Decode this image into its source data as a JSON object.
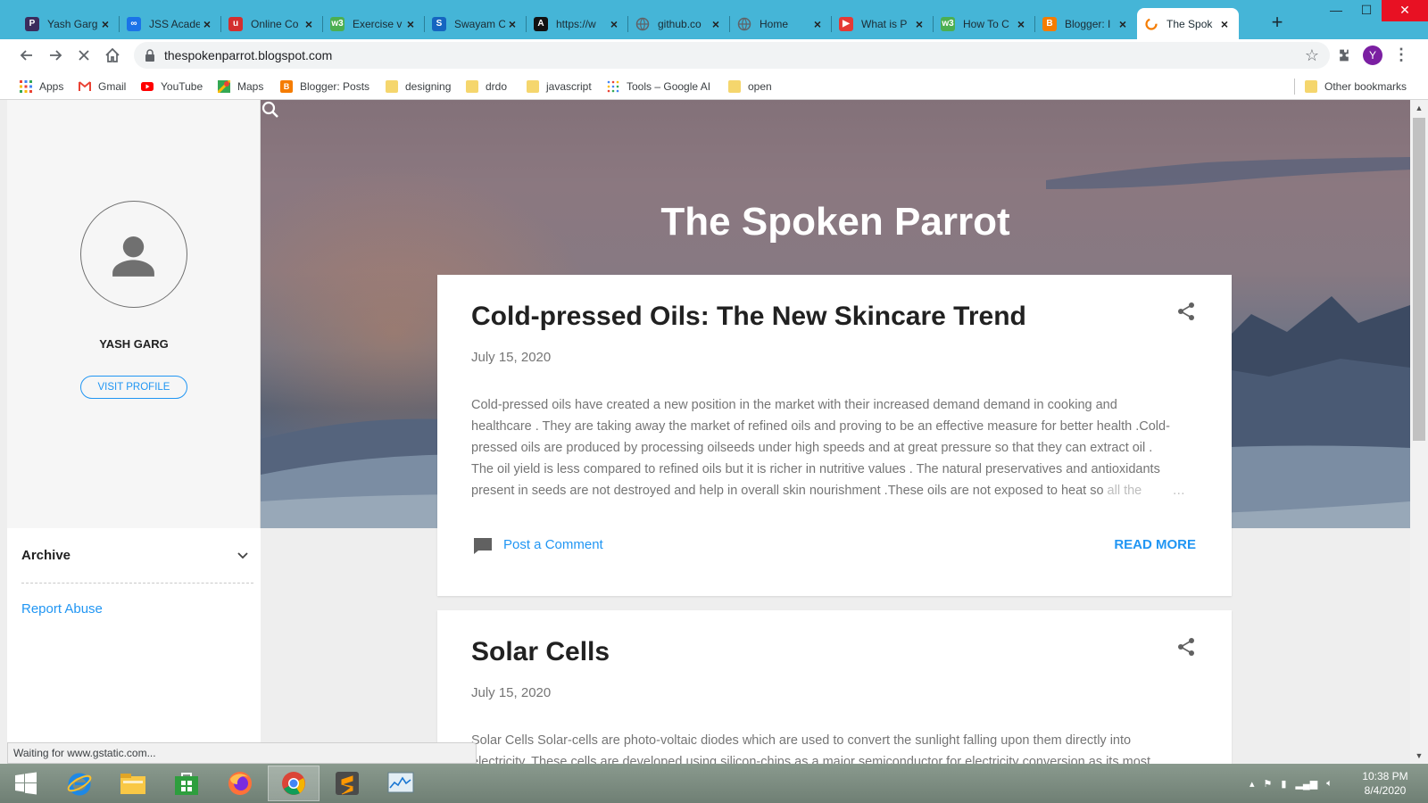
{
  "browser": {
    "tabs": [
      {
        "title": "Yash Garg",
        "color": "#3b2b5c",
        "icon_glyph": "P"
      },
      {
        "title": "JSS Acade",
        "color": "#1a73e8",
        "icon_glyph": "∞"
      },
      {
        "title": "Online Co",
        "color": "#d32f2f",
        "icon_glyph": "u"
      },
      {
        "title": "Exercise v",
        "color": "#4caf50",
        "icon_glyph": "w3"
      },
      {
        "title": "Swayam C",
        "color": "#1565c0",
        "icon_glyph": "S"
      },
      {
        "title": "https://w",
        "color": "#111111",
        "icon_glyph": "A"
      },
      {
        "title": "github.co",
        "color": "#5f6368",
        "icon_glyph": ""
      },
      {
        "title": "Home",
        "color": "#5f6368",
        "icon_glyph": ""
      },
      {
        "title": "What is P",
        "color": "#e53935",
        "icon_glyph": "▶"
      },
      {
        "title": "How To C",
        "color": "#4caf50",
        "icon_glyph": "w3"
      },
      {
        "title": "Blogger: I",
        "color": "#f57c00",
        "icon_glyph": "B"
      },
      {
        "title": "The Spok",
        "color": "#f57c00",
        "icon_glyph": ""
      }
    ],
    "active_tab_index": 11,
    "new_tab_label": "+",
    "url": "thespokenparrot.blogspot.com",
    "profile_initial": "Y",
    "bookmarks": [
      {
        "label": "Apps",
        "icon": "apps-grid-icon"
      },
      {
        "label": "Gmail",
        "icon": "gmail-icon"
      },
      {
        "label": "YouTube",
        "icon": "youtube-icon"
      },
      {
        "label": "Maps",
        "icon": "maps-icon"
      },
      {
        "label": "Blogger: Posts",
        "icon": "blogger-icon"
      },
      {
        "label": "designing",
        "icon": "folder-icon"
      },
      {
        "label": "drdo",
        "icon": "folder-icon"
      },
      {
        "label": "javascript",
        "icon": "folder-icon"
      },
      {
        "label": "Tools – Google AI",
        "icon": "google-ai-icon"
      },
      {
        "label": "open",
        "icon": "folder-icon"
      }
    ],
    "other_bookmarks": "Other bookmarks",
    "status_text": "Waiting for www.gstatic.com..."
  },
  "sidebar": {
    "profile_name": "YASH GARG",
    "visit_profile": "VISIT PROFILE",
    "archive_label": "Archive",
    "report_abuse": "Report Abuse"
  },
  "blog": {
    "title": "The Spoken Parrot",
    "posts": [
      {
        "title": "Cold-pressed Oils: The New Skincare Trend",
        "date": "July 15, 2020",
        "snippet_lines": [
          "Cold-pressed oils have created a new position in the market with their increased demand demand in cooking and",
          "healthcare . They are taking away the market of refined oils and proving to be an effective measure for better health .Cold-",
          "pressed oils are produced by processing oilseeds under high speeds and at great pressure so that they can extract oil .",
          "The oil yield is less compared to refined oils but it is richer in nutritive values . The natural preservatives and antioxidants",
          "present in seeds are not destroyed and help in overall skin nourishment .These oils are not exposed to heat so "
        ],
        "snippet_fade": "all the",
        "ellipsis": "…",
        "comment_label": "Post a Comment",
        "read_more": "READ MORE"
      },
      {
        "title": "Solar Cells",
        "date": "July 15, 2020",
        "snippet_lines": [
          "Solar Cells Solar-cells are photo-voltaic diodes which are used to convert the sunlight falling upon them directly into",
          "electricity. These cells are developed using silicon-chips as a major semiconductor for electricity conversion as its most"
        ]
      }
    ]
  },
  "taskbar": {
    "apps": [
      "start-icon",
      "internet-explorer-icon",
      "file-explorer-icon",
      "store-icon",
      "firefox-icon",
      "chrome-icon",
      "sublime-text-icon",
      "task-manager-icon"
    ],
    "time": "10:38 PM",
    "date": "8/4/2020"
  }
}
